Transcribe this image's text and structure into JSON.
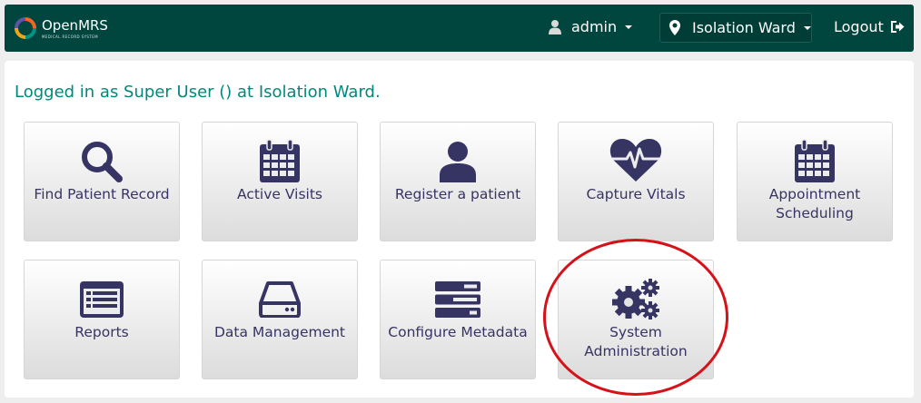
{
  "header": {
    "brand": "OpenMRS",
    "brand_sub": "MEDICAL RECORD SYSTEM",
    "user": "admin",
    "location": "Isolation Ward",
    "logout": "Logout"
  },
  "welcome": "Logged in as Super User () at Isolation Ward.",
  "apps": [
    {
      "label": "Find Patient Record",
      "icon": "search-icon"
    },
    {
      "label": "Active Visits",
      "icon": "calendar-icon"
    },
    {
      "label": "Register a patient",
      "icon": "user-icon"
    },
    {
      "label": "Capture Vitals",
      "icon": "heartbeat-icon"
    },
    {
      "label": "Appointment Scheduling",
      "icon": "calendar-icon"
    },
    {
      "label": "Reports",
      "icon": "list-alt-icon"
    },
    {
      "label": "Data Management",
      "icon": "hdd-icon"
    },
    {
      "label": "Configure Metadata",
      "icon": "tasks-icon"
    },
    {
      "label": "System Administration",
      "icon": "cogs-icon"
    }
  ],
  "colors": {
    "header_bg": "#00463f",
    "accent": "#00897b",
    "tile_text": "#363463",
    "highlight": "#d5121a"
  }
}
